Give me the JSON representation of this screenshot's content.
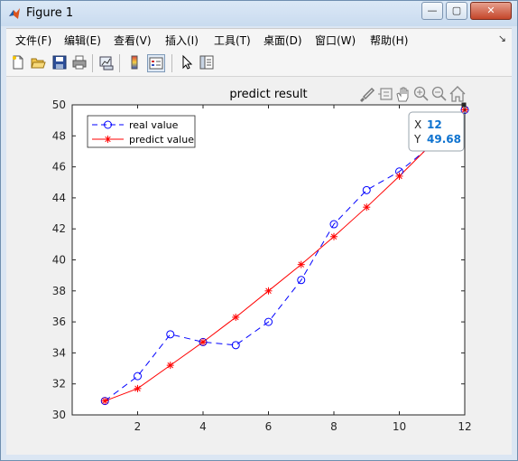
{
  "window": {
    "title": "Figure 1",
    "minimize_label": "—",
    "maximize_label": "▢",
    "close_label": "✕"
  },
  "menu": {
    "items": [
      "文件(F)",
      "编辑(E)",
      "查看(V)",
      "插入(I)",
      "工具(T)",
      "桌面(D)",
      "窗口(W)",
      "帮助(H)"
    ],
    "overflow_label": "↘"
  },
  "toolbar": {
    "icons": [
      "new-figure-icon",
      "open-file-icon",
      "save-icon",
      "print-icon",
      "link-plot-icon",
      "insert-colorbar-icon",
      "insert-legend-icon",
      "pointer-icon",
      "property-inspector-icon"
    ]
  },
  "axes_toolbar": {
    "icons": [
      "brush-icon",
      "datatip-icon",
      "pan-icon",
      "zoom-in-icon",
      "zoom-out-icon",
      "home-icon"
    ]
  },
  "datatip": {
    "x_label": "X",
    "x_value": "12",
    "y_label": "Y",
    "y_value": "49.68"
  },
  "colors": {
    "real": "#0000ff",
    "predict": "#ff0000",
    "datatip_value": "#0d72cf"
  },
  "chart_data": {
    "type": "line",
    "title": "predict result",
    "xlabel": "",
    "ylabel": "",
    "xlim": [
      0,
      12
    ],
    "ylim": [
      30,
      50
    ],
    "xticks": [
      2,
      4,
      6,
      8,
      10,
      12
    ],
    "yticks": [
      30,
      32,
      34,
      36,
      38,
      40,
      42,
      44,
      46,
      48,
      50
    ],
    "x": [
      1,
      2,
      3,
      4,
      5,
      6,
      7,
      8,
      9,
      10,
      11,
      12
    ],
    "series": [
      {
        "name": "real value",
        "marker": "circle",
        "line": "dashed",
        "values": [
          30.9,
          32.5,
          35.2,
          34.7,
          34.5,
          36.0,
          38.7,
          42.3,
          44.5,
          45.7,
          47.4,
          49.68
        ]
      },
      {
        "name": "predict value",
        "marker": "star",
        "line": "solid",
        "values": [
          30.9,
          31.7,
          33.2,
          34.7,
          36.3,
          38.0,
          39.7,
          41.5,
          43.4,
          45.4,
          47.5,
          49.68
        ]
      }
    ],
    "legend": "top-left",
    "grid": false
  }
}
